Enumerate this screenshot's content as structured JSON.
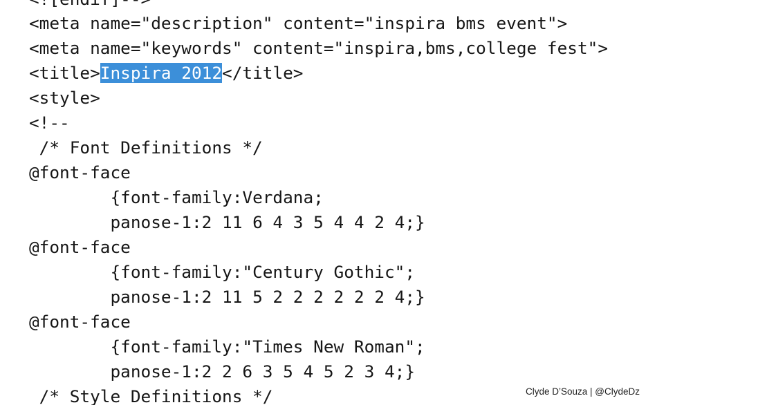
{
  "editor": {
    "lines": [
      "<![endif]-->",
      "<meta name=\"description\" content=\"inspira bms event\">",
      "<meta name=\"keywords\" content=\"inspira,bms,college fest\">",
      "<title>Inspira 2012</title>",
      "<style>",
      "<!--",
      " /* Font Definitions */",
      "@font-face",
      "\t{font-family:Verdana;",
      "\tpanose-1:2 11 6 4 3 5 4 4 2 4;}",
      "@font-face",
      "\t{font-family:\"Century Gothic\";",
      "\tpanose-1:2 11 5 2 2 2 2 2 2 4;}",
      "@font-face",
      "\t{font-family:\"Times New Roman\";",
      "\tpanose-1:2 2 6 3 5 4 5 2 3 4;}",
      " /* Style Definitions */"
    ],
    "title_line": {
      "open_tag": "<title>",
      "selected_text": "Inspira 2012",
      "close_tag": "</title>"
    },
    "selection_color": "#3c8fd9"
  },
  "watermark": {
    "text": "Clyde D’Souza | @ClydeDz"
  }
}
